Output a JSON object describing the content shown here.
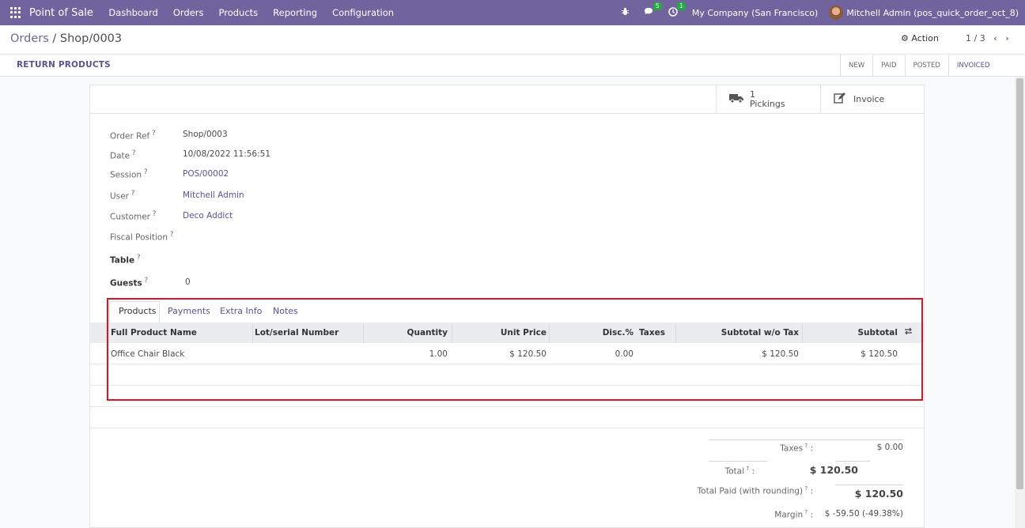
{
  "topbar": {
    "brand": "Point of Sale",
    "menu": [
      "Dashboard",
      "Orders",
      "Products",
      "Reporting",
      "Configuration"
    ],
    "messages_count": "5",
    "activities_count": "1",
    "company": "My Company (San Francisco)",
    "user": "Mitchell Admin (pos_quick_order_oct_8)"
  },
  "breadcrumb": {
    "parent": "Orders",
    "separator": " / ",
    "current": "Shop/0003"
  },
  "control": {
    "action_label": "Action",
    "pager": "1 / 3",
    "return_button": "RETURN PRODUCTS",
    "statuses": [
      "NEW",
      "PAID",
      "POSTED",
      "INVOICED"
    ],
    "current_status": "INVOICED"
  },
  "smart_buttons": {
    "pickings_count": "1",
    "pickings_label": "Pickings",
    "invoice_label": "Invoice"
  },
  "fields": {
    "order_ref": {
      "label": "Order Ref",
      "value": "Shop/0003"
    },
    "date": {
      "label": "Date",
      "value": "10/08/2022 11:56:51"
    },
    "session": {
      "label": "Session",
      "value": "POS/00002"
    },
    "user": {
      "label": "User",
      "value": "Mitchell Admin"
    },
    "customer": {
      "label": "Customer",
      "value": "Deco Addict"
    },
    "fiscal_position": {
      "label": "Fiscal Position",
      "value": ""
    },
    "table": {
      "label": "Table",
      "value": ""
    },
    "guests": {
      "label": "Guests",
      "value": "0"
    }
  },
  "tabs": [
    "Products",
    "Payments",
    "Extra Info",
    "Notes"
  ],
  "active_tab": "Products",
  "table": {
    "headers": [
      "Full Product Name",
      "Lot/serial Number",
      "Quantity",
      "Unit Price",
      "Disc.%",
      "Taxes",
      "Subtotal w/o Tax",
      "Subtotal"
    ],
    "rows": [
      {
        "name": "Office Chair Black",
        "lot": "",
        "qty": "1.00",
        "price": "$ 120.50",
        "disc": "0.00",
        "taxes": "",
        "subtotal_wo": "$ 120.50",
        "subtotal": "$ 120.50"
      }
    ]
  },
  "totals": {
    "taxes_label": "Taxes",
    "taxes_value": "$ 0.00",
    "total_label": "Total",
    "total_value": "$ 120.50",
    "paid_label": "Total Paid (with rounding)",
    "paid_value": "$ 120.50",
    "margin_label": "Margin",
    "margin_value": "$ -59.50 (-49.38%)"
  },
  "colors": {
    "brand": "#71639e",
    "link": "#5b5192",
    "highlight": "#e0141e"
  }
}
